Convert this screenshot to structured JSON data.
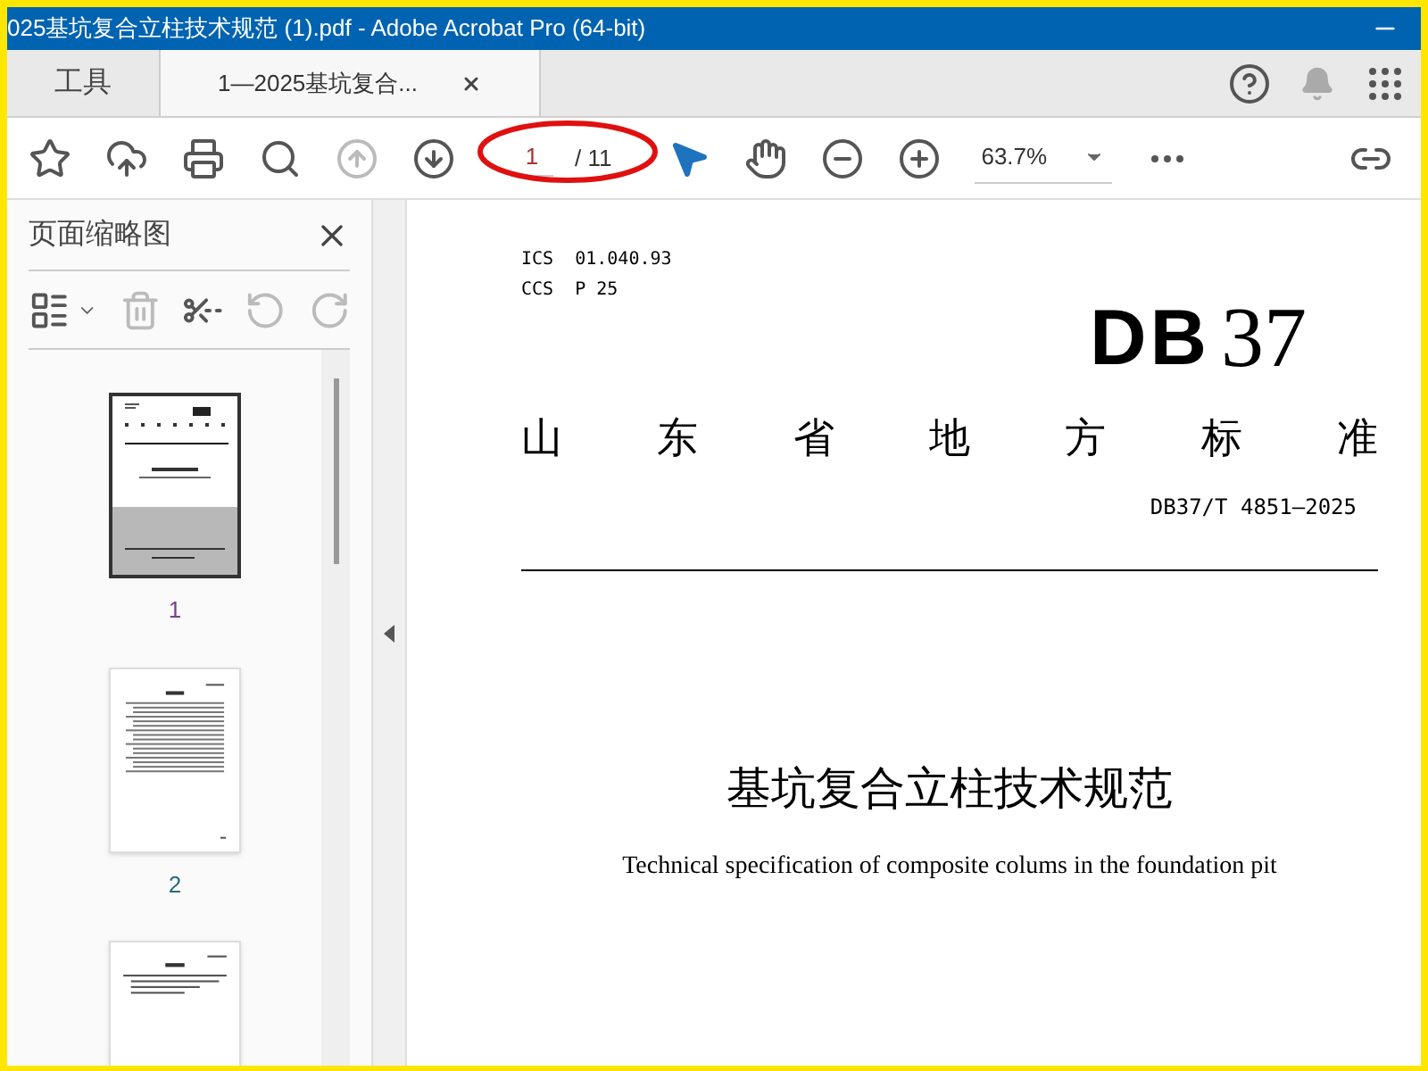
{
  "window": {
    "title": "025基坑复合立柱技术规范 (1).pdf - Adobe Acrobat Pro (64-bit)"
  },
  "tabs": [
    {
      "label": "工具",
      "selected": false
    },
    {
      "label": "1—2025基坑复合...",
      "selected": true,
      "closable": true
    }
  ],
  "toolbar": {
    "page_current": "1",
    "page_total": "/ 11",
    "zoom": "63.7%",
    "up_disabled": true,
    "down_disabled": false,
    "tools": [
      {
        "kind": "pointer",
        "selected": true
      },
      {
        "kind": "hand",
        "selected": false
      }
    ]
  },
  "sidebar": {
    "title": "页面缩略图",
    "thumbnails": [
      {
        "label": "1",
        "selected": true,
        "kind": "cover"
      },
      {
        "label": "2",
        "selected": false,
        "kind": "contents"
      },
      {
        "selected": false,
        "kind": "foreword"
      }
    ]
  },
  "document": {
    "ics": "ICS  01.040.93",
    "ccs": "CCS  P 25",
    "logo_letters": "DB",
    "logo_digits": "37",
    "heading": "山东省地方标准",
    "code": "DB37/T 4851—2025",
    "title": "基坑复合立柱技术规范",
    "subtitle": "Technical specification of composite colums in the foundation pit"
  }
}
